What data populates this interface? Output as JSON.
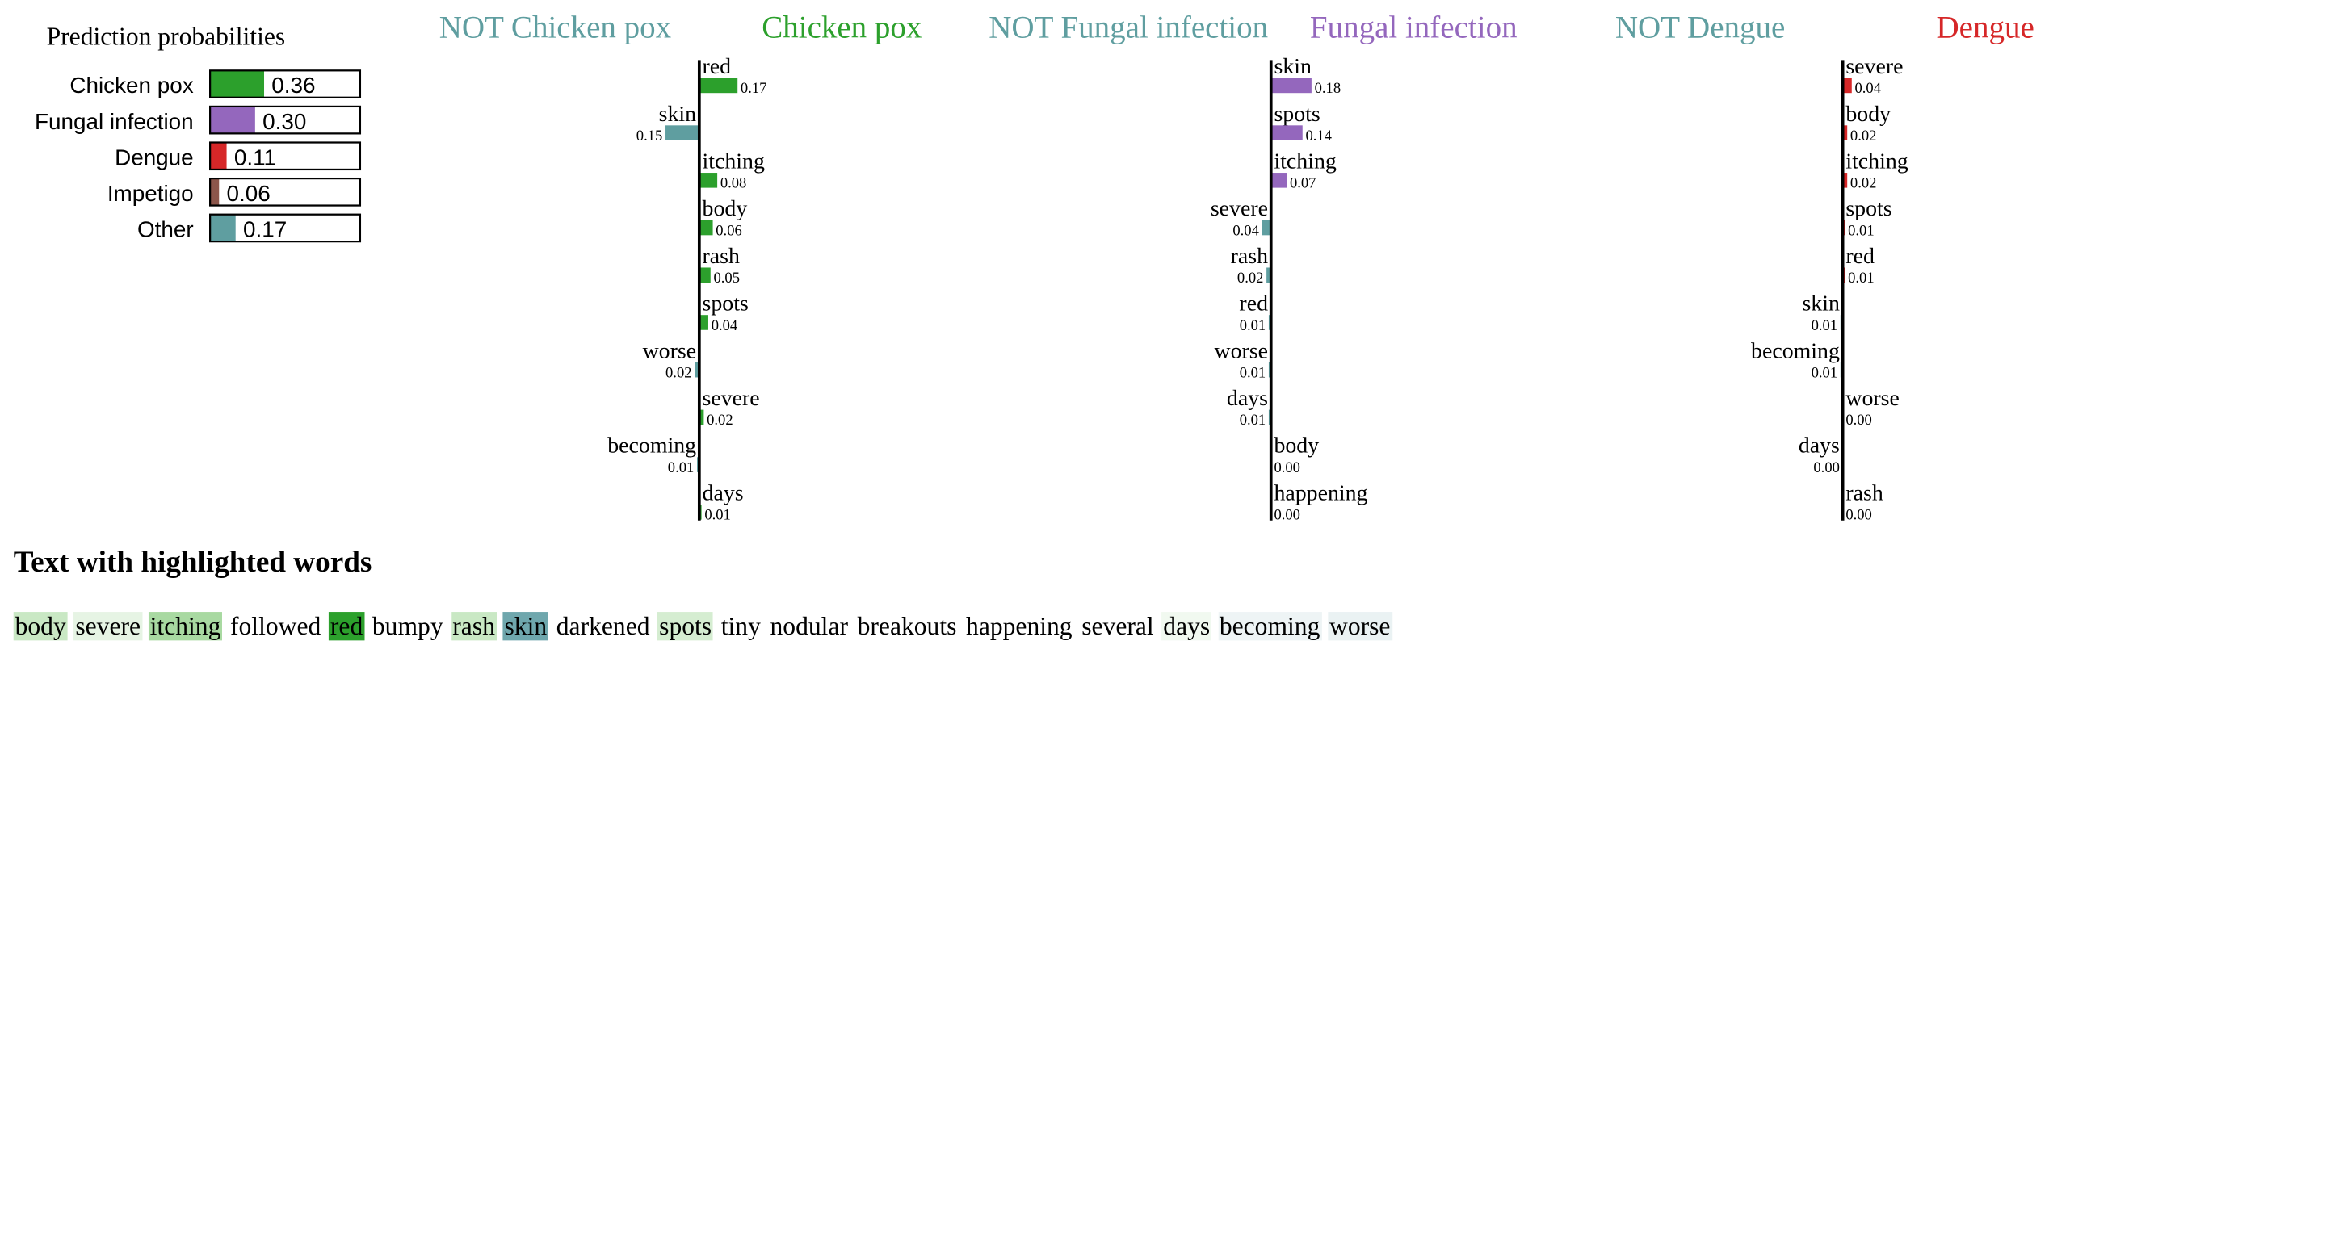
{
  "prediction_title": "Prediction probabilities",
  "probabilities": [
    {
      "label": "Chicken pox",
      "value": 0.36,
      "text": "0.36",
      "color": "#2ca02c"
    },
    {
      "label": "Fungal infection",
      "value": 0.3,
      "text": "0.30",
      "color": "#9467bd"
    },
    {
      "label": "Dengue",
      "value": 0.11,
      "text": "0.11",
      "color": "#d62728"
    },
    {
      "label": "Impetigo",
      "value": 0.06,
      "text": "0.06",
      "color": "#8c564b"
    },
    {
      "label": "Other",
      "value": 0.17,
      "text": "0.17",
      "color": "#5f9ea0"
    }
  ],
  "colors": {
    "negative": "#5f9ea0"
  },
  "chart_data": [
    {
      "type": "bar",
      "title_negative": "NOT Chicken pox",
      "title_positive": "Chicken pox",
      "positive_color": "#2ca02c",
      "features": [
        {
          "word": "red",
          "value": 0.17,
          "text": "0.17"
        },
        {
          "word": "skin",
          "value": -0.15,
          "text": "0.15"
        },
        {
          "word": "itching",
          "value": 0.08,
          "text": "0.08"
        },
        {
          "word": "body",
          "value": 0.06,
          "text": "0.06"
        },
        {
          "word": "rash",
          "value": 0.05,
          "text": "0.05"
        },
        {
          "word": "spots",
          "value": 0.04,
          "text": "0.04"
        },
        {
          "word": "worse",
          "value": -0.02,
          "text": "0.02"
        },
        {
          "word": "severe",
          "value": 0.02,
          "text": "0.02"
        },
        {
          "word": "becoming",
          "value": -0.01,
          "text": "0.01"
        },
        {
          "word": "days",
          "value": 0.01,
          "text": "0.01"
        }
      ]
    },
    {
      "type": "bar",
      "title_negative": "NOT Fungal infection",
      "title_positive": "Fungal infection",
      "positive_color": "#9467bd",
      "features": [
        {
          "word": "skin",
          "value": 0.18,
          "text": "0.18"
        },
        {
          "word": "spots",
          "value": 0.14,
          "text": "0.14"
        },
        {
          "word": "itching",
          "value": 0.07,
          "text": "0.07"
        },
        {
          "word": "severe",
          "value": -0.04,
          "text": "0.04"
        },
        {
          "word": "rash",
          "value": -0.02,
          "text": "0.02"
        },
        {
          "word": "red",
          "value": -0.01,
          "text": "0.01"
        },
        {
          "word": "worse",
          "value": -0.01,
          "text": "0.01"
        },
        {
          "word": "days",
          "value": -0.01,
          "text": "0.01"
        },
        {
          "word": "body",
          "value": 0.0,
          "text": "0.00"
        },
        {
          "word": "happening",
          "value": 0.0,
          "text": "0.00"
        }
      ]
    },
    {
      "type": "bar",
      "title_negative": "NOT Dengue",
      "title_positive": "Dengue",
      "positive_color": "#d62728",
      "features": [
        {
          "word": "severe",
          "value": 0.04,
          "text": "0.04"
        },
        {
          "word": "body",
          "value": 0.02,
          "text": "0.02"
        },
        {
          "word": "itching",
          "value": 0.02,
          "text": "0.02"
        },
        {
          "word": "spots",
          "value": 0.01,
          "text": "0.01"
        },
        {
          "word": "red",
          "value": 0.01,
          "text": "0.01"
        },
        {
          "word": "skin",
          "value": -0.01,
          "text": "0.01"
        },
        {
          "word": "becoming",
          "value": -0.01,
          "text": "0.01"
        },
        {
          "word": "worse",
          "value": 0.0,
          "text": "0.00"
        },
        {
          "word": "days",
          "value": -0.0,
          "text": "0.00"
        },
        {
          "word": "rash",
          "value": 0.0,
          "text": "0.00"
        }
      ]
    }
  ],
  "highlight": {
    "title": "Text with highlighted words",
    "words": [
      {
        "text": "body",
        "bg": "#c9e8c4"
      },
      {
        "text": "severe",
        "bg": "#e6f4e4"
      },
      {
        "text": "itching",
        "bg": "#a8d9a1"
      },
      {
        "text": "followed",
        "bg": ""
      },
      {
        "text": "red",
        "bg": "#2ca02c"
      },
      {
        "text": "bumpy",
        "bg": ""
      },
      {
        "text": "rash",
        "bg": "#c9e8c4"
      },
      {
        "text": "skin",
        "bg": "#6fa7ad"
      },
      {
        "text": "darkened",
        "bg": ""
      },
      {
        "text": "spots",
        "bg": "#d5edd1"
      },
      {
        "text": "tiny",
        "bg": ""
      },
      {
        "text": "nodular",
        "bg": ""
      },
      {
        "text": "breakouts",
        "bg": ""
      },
      {
        "text": "happening",
        "bg": ""
      },
      {
        "text": "several",
        "bg": ""
      },
      {
        "text": "days",
        "bg": "#f1f9f0"
      },
      {
        "text": "becoming",
        "bg": "#eef4f5"
      },
      {
        "text": "worse",
        "bg": "#eaf2f3"
      }
    ]
  }
}
